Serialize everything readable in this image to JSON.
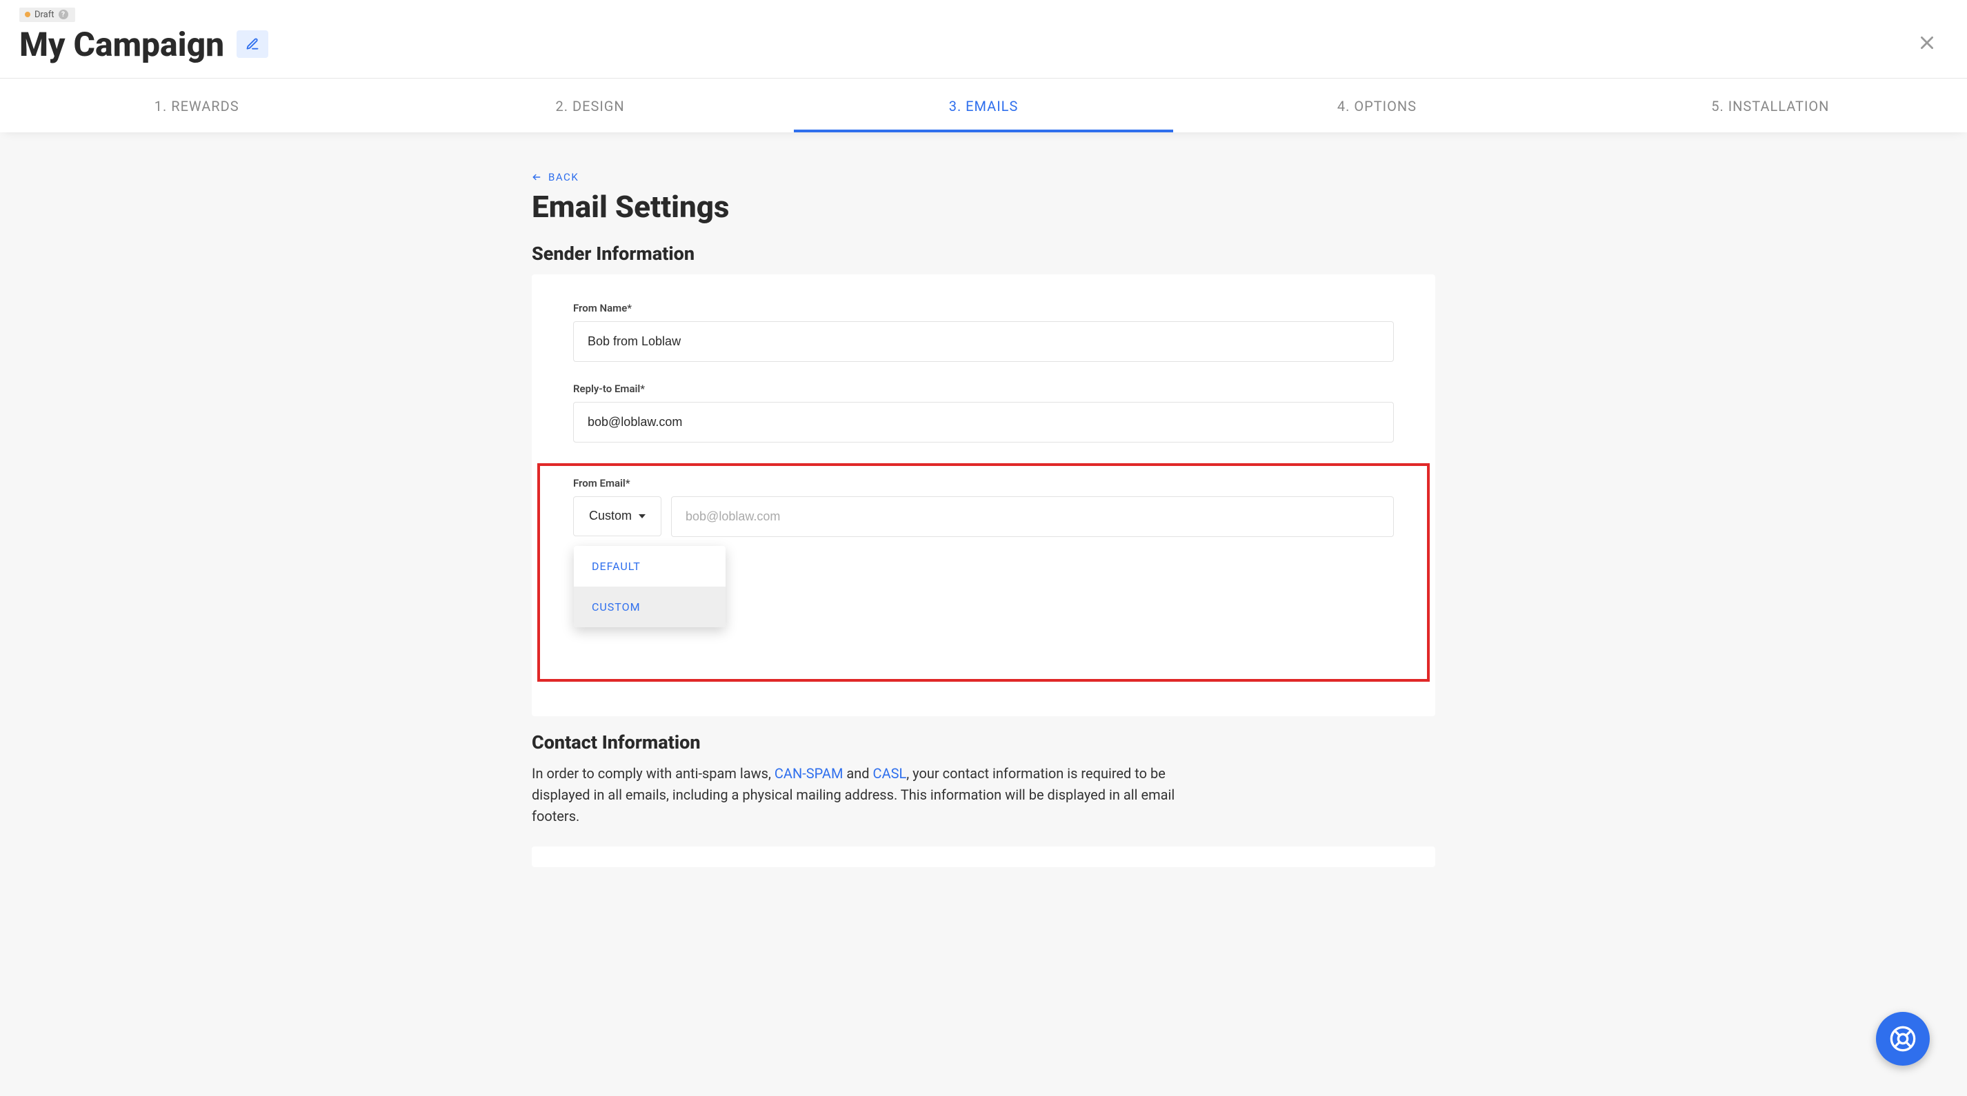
{
  "header": {
    "draft_label": "Draft",
    "title": "My Campaign"
  },
  "tabs": [
    {
      "label": "1. REWARDS"
    },
    {
      "label": "2. DESIGN"
    },
    {
      "label": "3. EMAILS",
      "active": true
    },
    {
      "label": "4. OPTIONS"
    },
    {
      "label": "5. INSTALLATION"
    }
  ],
  "back_label": "BACK",
  "page_heading": "Email Settings",
  "sender": {
    "section_title": "Sender Information",
    "from_name_label": "From Name*",
    "from_name_value": "Bob from Loblaw",
    "reply_to_label": "Reply-to Email*",
    "reply_to_value": "bob@loblaw.com",
    "from_email_label": "From Email*",
    "from_email_dropdown_value": "Custom",
    "from_email_placeholder": "bob@loblaw.com",
    "dropdown_options": {
      "default": "DEFAULT",
      "custom": "CUSTOM"
    }
  },
  "contact": {
    "section_title": "Contact Information",
    "text_pre": "In order to comply with anti-spam laws, ",
    "link_canspam": "CAN-SPAM",
    "text_and": " and ",
    "link_casl": "CASL",
    "text_post": ", your contact information is required to be displayed in all emails, including a physical mailing address. This information will be displayed in all email footers."
  },
  "colors": {
    "accent": "#2f6fed",
    "highlight_border": "#e02828"
  }
}
